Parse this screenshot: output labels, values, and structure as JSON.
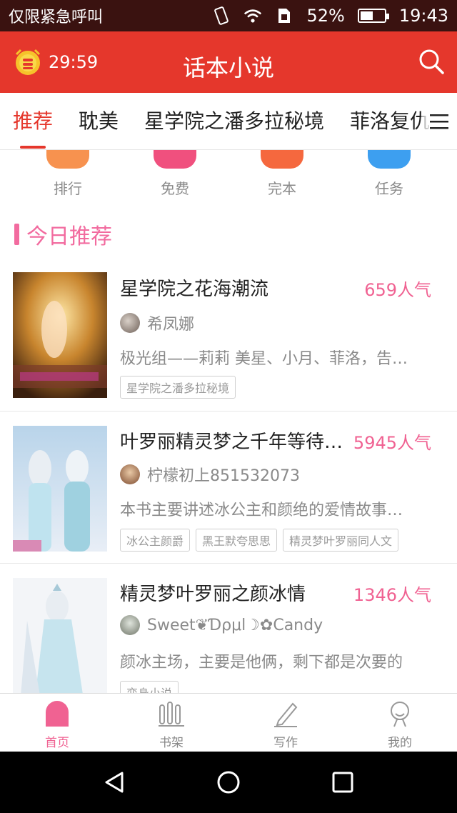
{
  "status_bar": {
    "carrier": "仅限紧急呼叫",
    "battery_percent": "52%",
    "battery_level": 0.52,
    "time": "19:43",
    "icons": [
      "vibrate-icon",
      "wifi-icon",
      "sim-icon",
      "battery-icon"
    ]
  },
  "header": {
    "timer": "29:59",
    "title": "话本小说",
    "colors": {
      "bar": "#e5372c"
    }
  },
  "tabs": [
    {
      "label": "推荐",
      "active": true
    },
    {
      "label": "耽美"
    },
    {
      "label": "星学院之潘多拉秘境"
    },
    {
      "label": "菲洛复仇"
    }
  ],
  "categories": [
    {
      "label": "排行",
      "color": "#f7924f"
    },
    {
      "label": "免费",
      "color": "#f0507e"
    },
    {
      "label": "完本",
      "color": "#f5683e"
    },
    {
      "label": "任务",
      "color": "#3d9ff0"
    }
  ],
  "section": {
    "title": "今日推荐"
  },
  "books": [
    {
      "title": "星学院之花海潮流",
      "popularity": "659人气",
      "author": "希凤娜",
      "desc": "极光组——莉莉 美星、小月、菲洛，告…",
      "tags": [
        "星学院之潘多拉秘境"
      ]
    },
    {
      "title": "叶罗丽精灵梦之千年等待…",
      "popularity": "5945人气",
      "author": "柠檬初上851532073",
      "desc": "本书主要讲述冰公主和颜绝的爱情故事…",
      "tags": [
        "冰公主颜爵",
        "黑王默夸思思",
        "精灵梦叶罗丽同人文"
      ]
    },
    {
      "title": "精灵梦叶罗丽之颜冰情",
      "popularity": "1346人气",
      "author": "Sweet❦Ɗρμl☽✿Candy",
      "desc": "颜冰主场，主要是他俩，剩下都是次要的",
      "tags": [
        "变身小说"
      ]
    }
  ],
  "bottom_nav": [
    {
      "label": "首页",
      "icon": "home-icon",
      "active": true
    },
    {
      "label": "书架",
      "icon": "bookshelf-icon"
    },
    {
      "label": "写作",
      "icon": "pen-icon"
    },
    {
      "label": "我的",
      "icon": "profile-icon"
    }
  ],
  "colors": {
    "accent_pink": "#f06292",
    "header_red": "#e5372c"
  }
}
